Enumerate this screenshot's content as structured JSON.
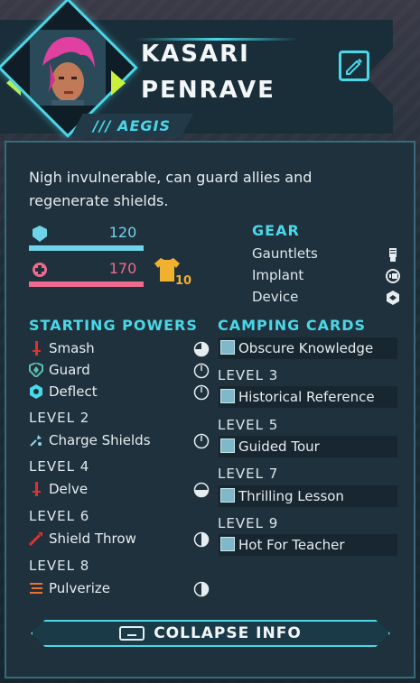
{
  "character": {
    "first_name": "KASARI",
    "last_name": "PENRAVE",
    "class_label": "/// AEGIS",
    "description": "Nigh invulnerable, can guard allies and regenerate shields."
  },
  "stats": {
    "shield": {
      "value": "120",
      "fill": 1.0,
      "color": "#6fd4ea"
    },
    "health": {
      "value": "170",
      "fill": 1.0,
      "color": "#ef6a8e"
    },
    "armor": {
      "value": "10",
      "color": "#f0b030"
    }
  },
  "gear": {
    "title": "GEAR",
    "items": [
      {
        "label": "Gauntlets",
        "icon": "gauntlet-icon"
      },
      {
        "label": "Implant",
        "icon": "implant-icon"
      },
      {
        "label": "Device",
        "icon": "device-icon"
      }
    ]
  },
  "powers": {
    "title": "STARTING POWERS",
    "starting": [
      {
        "label": "Smash",
        "icon": "smash-icon",
        "icon_color": "#e03030",
        "clock": "three-quarter"
      },
      {
        "label": "Guard",
        "icon": "guard-icon",
        "icon_color": "#5cc0b0",
        "clock": "empty"
      },
      {
        "label": "Deflect",
        "icon": "deflect-icon",
        "icon_color": "#4ad8e8",
        "clock": "empty"
      }
    ],
    "levels": [
      {
        "level": "LEVEL 2",
        "label": "Charge Shields",
        "icon": "charge-shields-icon",
        "icon_color": "#8ad8e8",
        "clock": "empty"
      },
      {
        "level": "LEVEL 4",
        "label": "Delve",
        "icon": "delve-icon",
        "icon_color": "#e03030",
        "clock": "quarter"
      },
      {
        "level": "LEVEL 6",
        "label": "Shield Throw",
        "icon": "shield-throw-icon",
        "icon_color": "#e03030",
        "clock": "half"
      },
      {
        "level": "LEVEL 8",
        "label": "Pulverize",
        "icon": "pulverize-icon",
        "icon_color": "#f07030",
        "clock": "half"
      }
    ]
  },
  "camping": {
    "title": "CAMPING CARDS",
    "starting": [
      {
        "label": "Obscure Knowledge"
      }
    ],
    "levels": [
      {
        "level": "LEVEL 3",
        "label": "Historical Reference"
      },
      {
        "level": "LEVEL 5",
        "label": "Guided Tour"
      },
      {
        "level": "LEVEL 7",
        "label": "Thrilling Lesson"
      },
      {
        "level": "LEVEL 9",
        "label": "Hot For Teacher"
      }
    ]
  },
  "collapse_button": {
    "label": "COLLAPSE INFO"
  },
  "colors": {
    "accent": "#4ad8e8",
    "lime": "#c8f03c",
    "panel": "#1f313c"
  }
}
